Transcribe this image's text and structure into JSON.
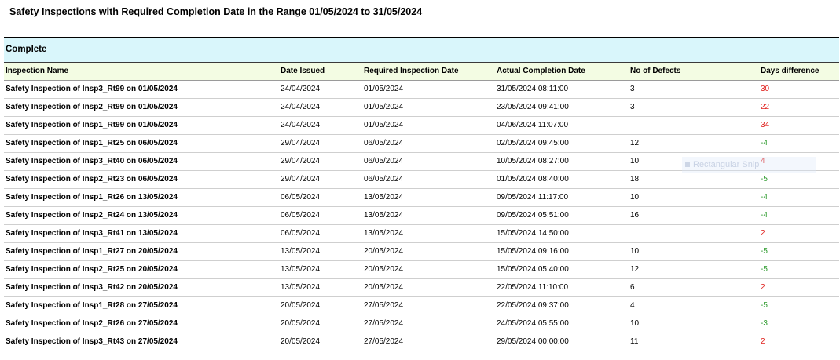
{
  "report": {
    "title": "Safety Inspections with Required Completion Date in the Range 01/05/2024 to 31/05/2024",
    "section": "Complete",
    "columns": [
      "Inspection Name",
      "Date Issued",
      "Required Inspection Date",
      "Actual Completion Date",
      "No of Defects",
      "Days difference"
    ],
    "rows": [
      {
        "name": "Safety Inspection of Insp3_Rt99 on 01/05/2024",
        "issued": "24/04/2024",
        "required": "01/05/2024",
        "actual": "31/05/2024  08:11:00",
        "defects": "3",
        "diff": "30"
      },
      {
        "name": "Safety Inspection of Insp2_Rt99 on 01/05/2024",
        "issued": "24/04/2024",
        "required": "01/05/2024",
        "actual": "23/05/2024  09:41:00",
        "defects": "3",
        "diff": "22"
      },
      {
        "name": "Safety Inspection of Insp1_Rt99 on 01/05/2024",
        "issued": "24/04/2024",
        "required": "01/05/2024",
        "actual": "04/06/2024  11:07:00",
        "defects": "",
        "diff": "34"
      },
      {
        "name": "Safety Inspection of Insp1_Rt25 on 06/05/2024",
        "issued": "29/04/2024",
        "required": "06/05/2024",
        "actual": "02/05/2024  09:45:00",
        "defects": "12",
        "diff": "-4"
      },
      {
        "name": "Safety Inspection of Insp3_Rt40 on 06/05/2024",
        "issued": "29/04/2024",
        "required": "06/05/2024",
        "actual": "10/05/2024  08:27:00",
        "defects": "10",
        "diff": "4"
      },
      {
        "name": "Safety Inspection of Insp2_Rt23 on 06/05/2024",
        "issued": "29/04/2024",
        "required": "06/05/2024",
        "actual": "01/05/2024  08:40:00",
        "defects": "18",
        "diff": "-5"
      },
      {
        "name": "Safety Inspection of Insp1_Rt26 on 13/05/2024",
        "issued": "06/05/2024",
        "required": "13/05/2024",
        "actual": "09/05/2024  11:17:00",
        "defects": "10",
        "diff": "-4"
      },
      {
        "name": "Safety Inspection of Insp2_Rt24 on 13/05/2024",
        "issued": "06/05/2024",
        "required": "13/05/2024",
        "actual": "09/05/2024  05:51:00",
        "defects": "16",
        "diff": "-4"
      },
      {
        "name": "Safety Inspection of Insp3_Rt41 on 13/05/2024",
        "issued": "06/05/2024",
        "required": "13/05/2024",
        "actual": "15/05/2024  14:50:00",
        "defects": "",
        "diff": "2"
      },
      {
        "name": "Safety Inspection of Insp1_Rt27 on 20/05/2024",
        "issued": "13/05/2024",
        "required": "20/05/2024",
        "actual": "15/05/2024  09:16:00",
        "defects": "10",
        "diff": "-5"
      },
      {
        "name": "Safety Inspection of Insp2_Rt25 on 20/05/2024",
        "issued": "13/05/2024",
        "required": "20/05/2024",
        "actual": "15/05/2024  05:40:00",
        "defects": "12",
        "diff": "-5"
      },
      {
        "name": "Safety Inspection of Insp3_Rt42 on 20/05/2024",
        "issued": "13/05/2024",
        "required": "20/05/2024",
        "actual": "22/05/2024  11:10:00",
        "defects": "6",
        "diff": "2"
      },
      {
        "name": "Safety Inspection of Insp1_Rt28 on 27/05/2024",
        "issued": "20/05/2024",
        "required": "27/05/2024",
        "actual": "22/05/2024  09:37:00",
        "defects": "4",
        "diff": "-5"
      },
      {
        "name": "Safety Inspection of Insp2_Rt26 on 27/05/2024",
        "issued": "20/05/2024",
        "required": "27/05/2024",
        "actual": "24/05/2024  05:55:00",
        "defects": "10",
        "diff": "-3"
      },
      {
        "name": "Safety Inspection of Insp3_Rt43 on 27/05/2024",
        "issued": "20/05/2024",
        "required": "27/05/2024",
        "actual": "29/05/2024  00:00:00",
        "defects": "11",
        "diff": "2"
      }
    ]
  },
  "overlay": {
    "label": "Rectangular Snip",
    "icon": "snip-icon"
  },
  "colors": {
    "section_bg": "#d9f6fb",
    "header_bg": "#f3fce3",
    "late": "#e0201c",
    "early": "#2b9a2b"
  }
}
